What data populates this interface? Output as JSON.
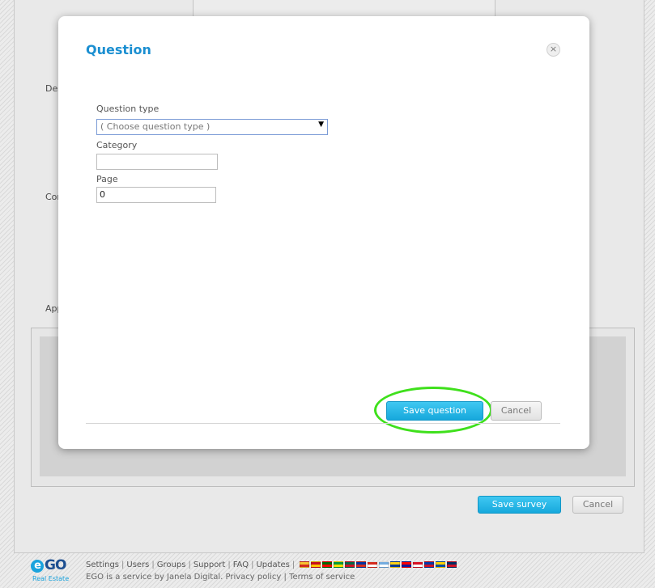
{
  "background": {
    "labels": {
      "description": "Desc",
      "company": "Comp",
      "appearance": "Appe"
    },
    "save_survey_label": "Save survey",
    "cancel_label": "Cancel"
  },
  "modal": {
    "title": "Question",
    "close_icon": "×",
    "question_type": {
      "label": "Question type",
      "selected": "( Choose question type )",
      "arrow": "▼"
    },
    "category": {
      "label": "Category",
      "value": ""
    },
    "page": {
      "label": "Page",
      "value": "0"
    },
    "save_label": "Save question",
    "cancel_label": "Cancel"
  },
  "footer": {
    "logo_text": "GO",
    "logo_e": "e",
    "logo_subtitle": "Real Estate",
    "links": [
      "Settings",
      "Users",
      "Groups",
      "Support",
      "FAQ",
      "Updates"
    ],
    "separator": "|",
    "credit_prefix": "EGO is a service by Janela Digital.",
    "privacy": "Privacy policy",
    "terms": "Terms of service",
    "flag_colors": [
      [
        "#f6c22f",
        "#d52b1e"
      ],
      [
        "#c60b1e",
        "#ffc400"
      ],
      [
        "#006600",
        "#ff0000"
      ],
      [
        "#009c3b",
        "#ffdf00"
      ],
      [
        "#006847",
        "#ce1126"
      ],
      [
        "#0033a0",
        "#d52b1e"
      ],
      [
        "#d52b1e",
        "#ffffff"
      ],
      [
        "#74acdf",
        "#ffffff"
      ],
      [
        "#fcd116",
        "#003893"
      ],
      [
        "#ff0000",
        "#171796"
      ],
      [
        "#d91023",
        "#ffffff"
      ],
      [
        "#0038a8",
        "#ce1126"
      ],
      [
        "#ffd100",
        "#034ea2"
      ],
      [
        "#002d62",
        "#ce1126"
      ]
    ]
  },
  "colors": {
    "accent": "#1aa3dd",
    "title_blue": "#1b8fd1",
    "highlight_green": "#3fe01c"
  }
}
